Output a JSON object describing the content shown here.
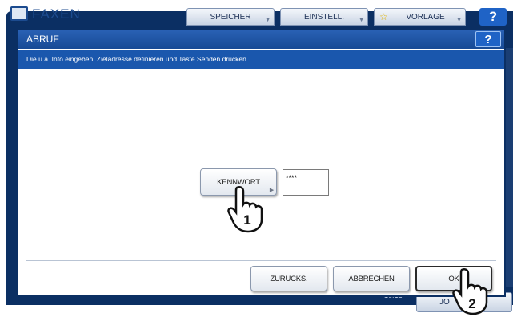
{
  "background": {
    "app_title": "FAXEN",
    "tabs": [
      {
        "label": "SPEICHER"
      },
      {
        "label": "EINSTELL."
      },
      {
        "label": "VORLAGE"
      }
    ],
    "help_label": "?",
    "clock": "16:12",
    "bottom_button_label": "JO"
  },
  "dialog": {
    "title": "ABRUF",
    "help_label": "?",
    "info_text": "Die u.a. Info eingeben. Zieladresse definieren und Taste Senden drucken.",
    "password_button_label": "KENNWORT",
    "password_value": "****",
    "back_button_label": "ZURÜCKS.",
    "cancel_button_label": "ABBRECHEN",
    "ok_button_label": "OK"
  },
  "annotations": {
    "step1": "1",
    "step2": "2"
  },
  "colors": {
    "frame": "#0b2f63",
    "header": "#1f55a6",
    "info_bar": "#1a57ad",
    "help_button": "#1f63c6"
  }
}
